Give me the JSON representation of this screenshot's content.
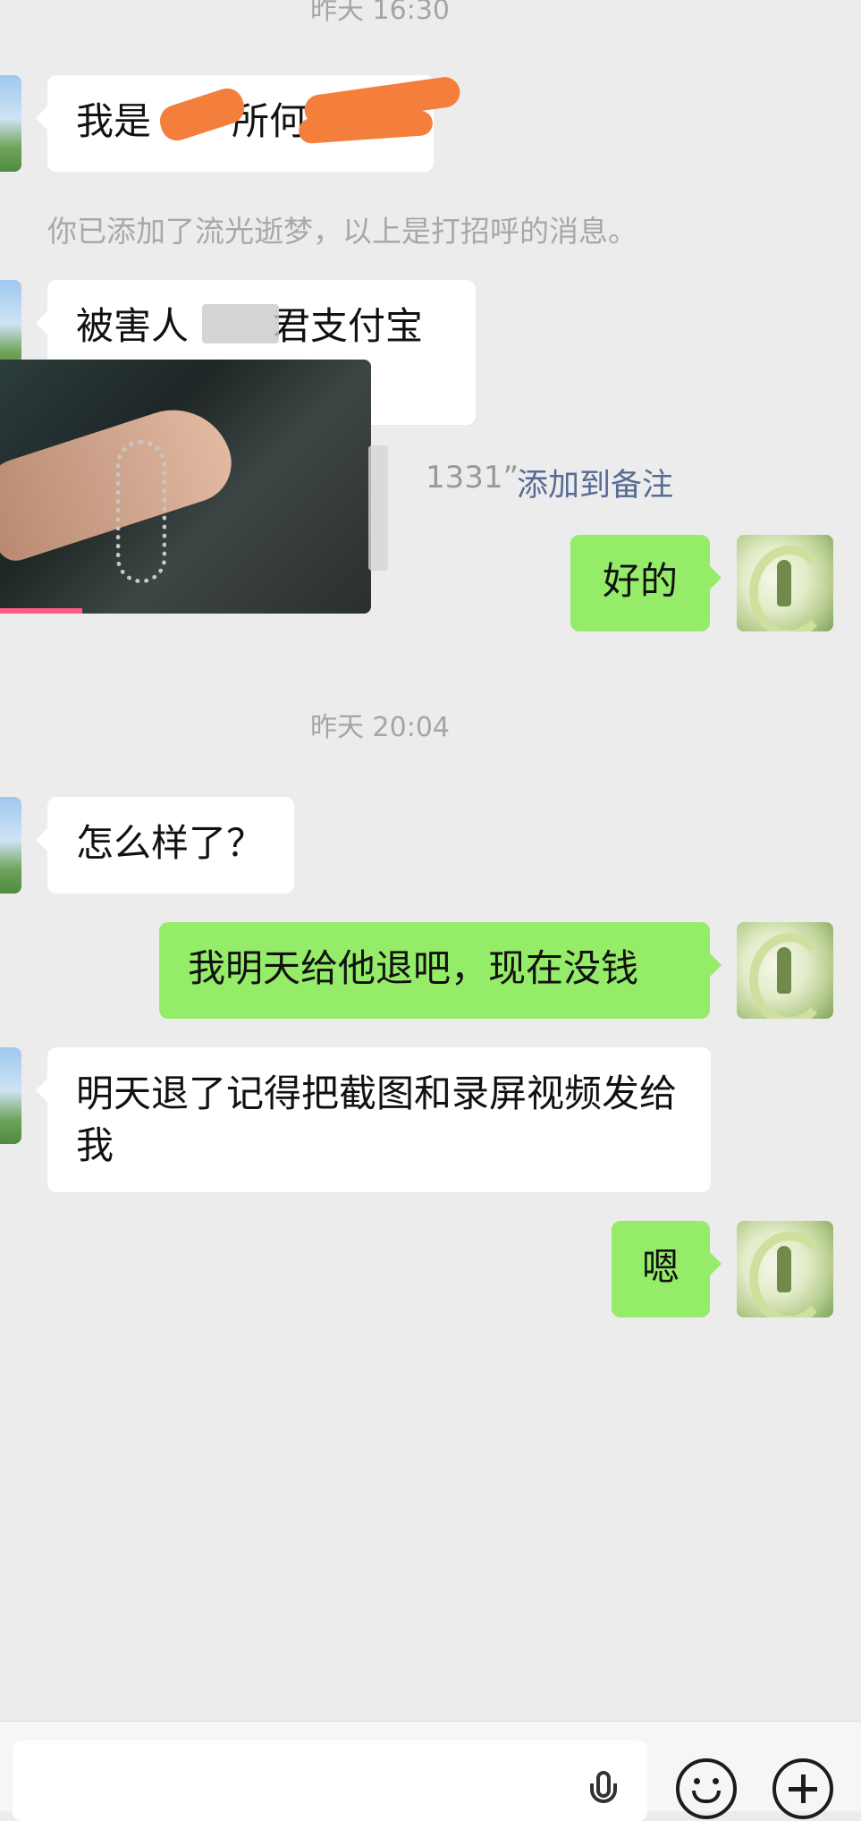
{
  "timestamps": {
    "top": "昨天 16:30",
    "middle": "昨天 20:04"
  },
  "messages": {
    "m1_prefix": "我是",
    "m1_mid": "所何",
    "system_notice": "你已添加了流光逝梦，以上是打招呼的消息。",
    "m2_prefix": "被害人",
    "m2_suffix": "君支付宝",
    "m2_note_number": "1331”",
    "m2_note_link": "添加到备注",
    "m3_out": "好的",
    "m4_in": "怎么样了？",
    "m5_out": "我明天给他退吧，现在没钱",
    "m6_in": "明天退了记得把截图和录屏视频发给我",
    "m7_out": "嗯"
  },
  "colors": {
    "background": "#ececec",
    "incoming_bubble": "#ffffff",
    "outgoing_bubble": "#95ec69",
    "link": "#576b95",
    "redaction": "#f47f3c"
  },
  "icons": {
    "voice": "microphone-icon",
    "emoji": "emoji-icon",
    "more": "plus-circle-icon"
  }
}
